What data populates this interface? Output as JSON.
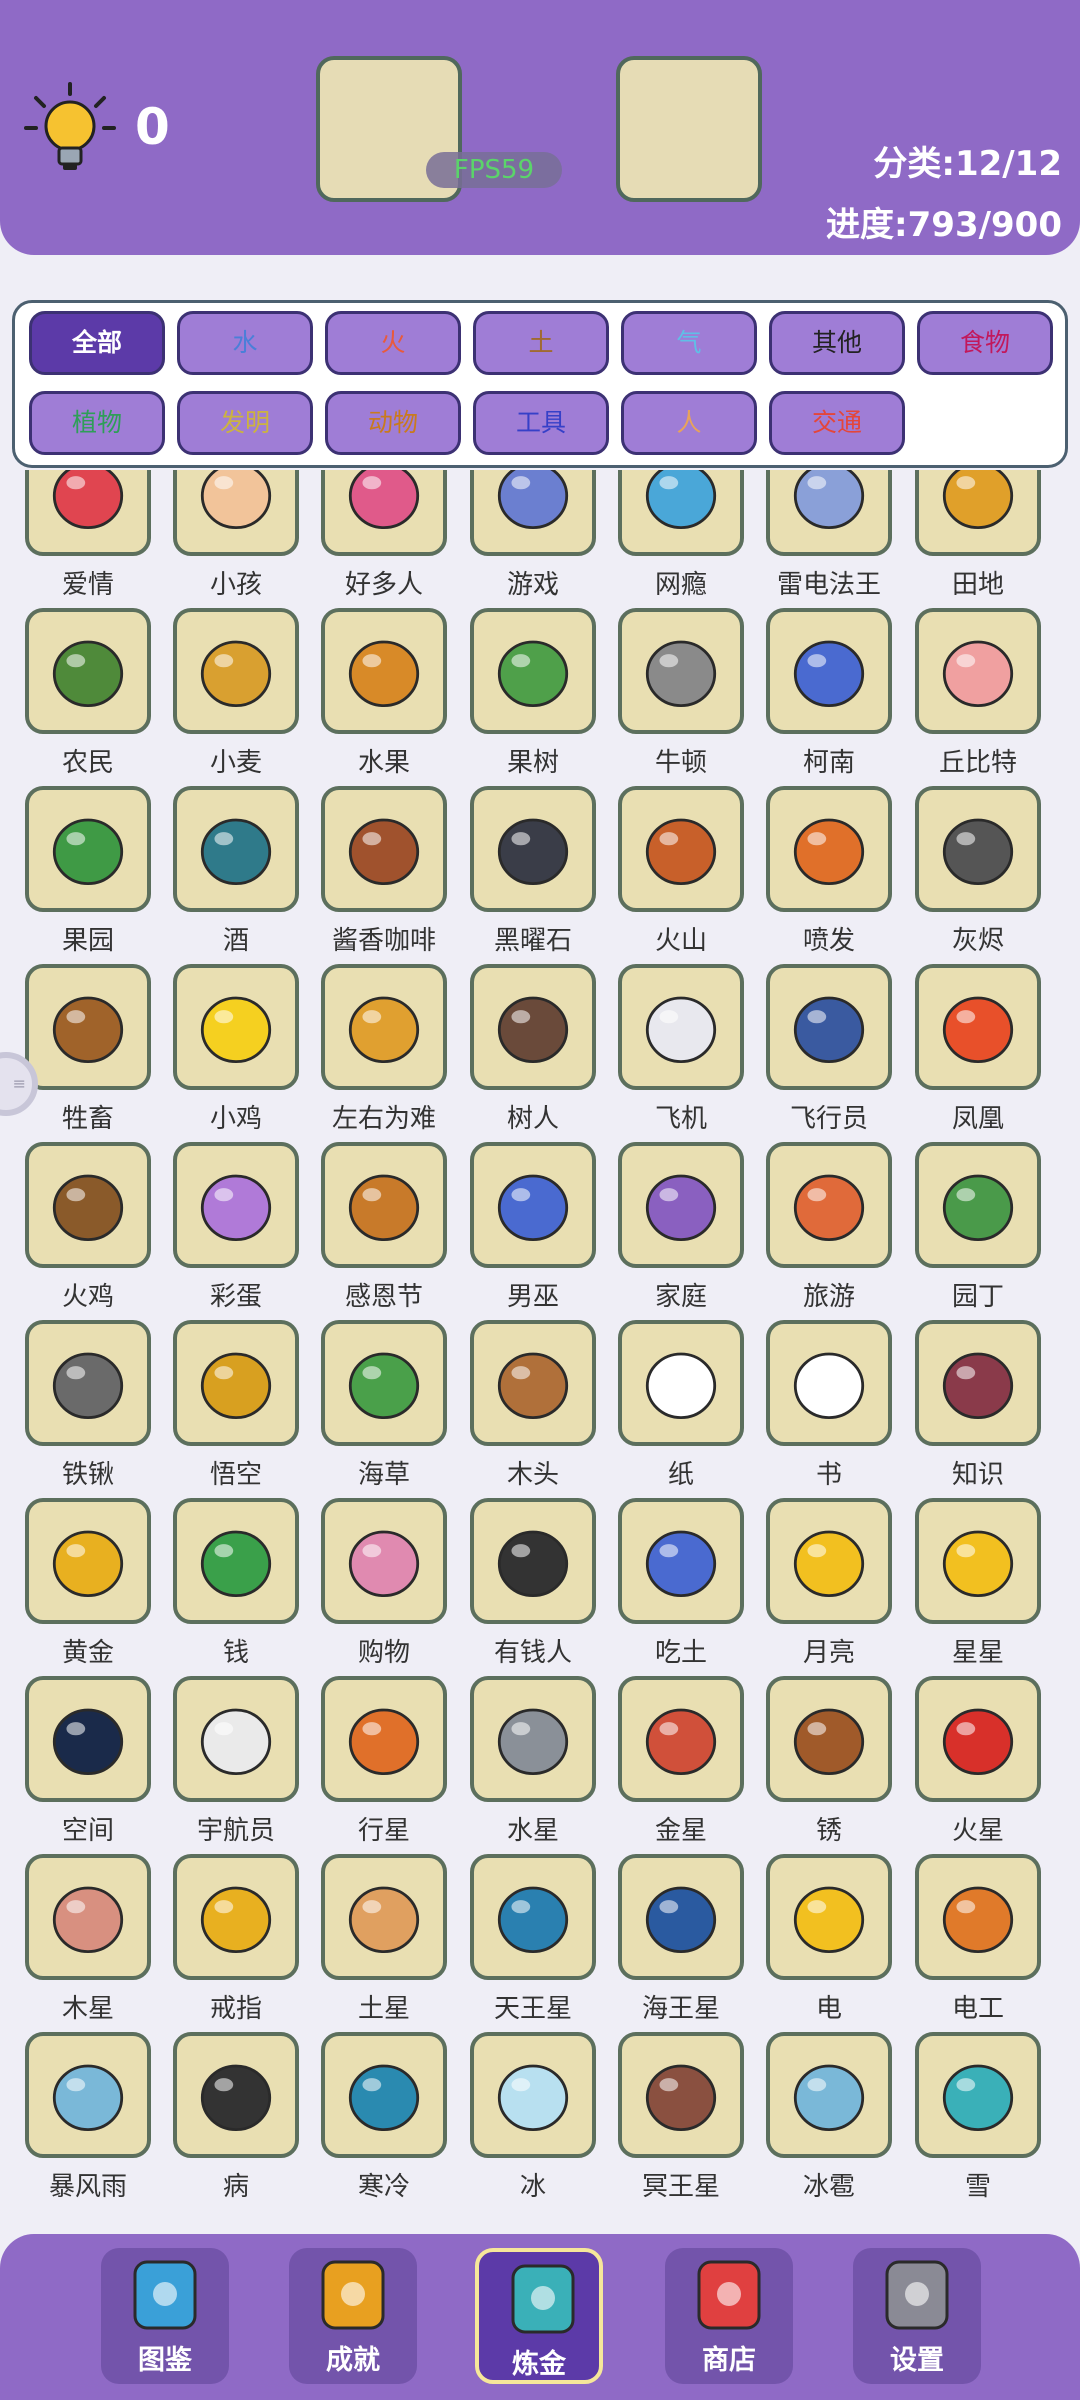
{
  "header": {
    "hint_count": "0",
    "fps": "FPS59",
    "category_text": "分类:12/12",
    "progress_text": "进度:793/900"
  },
  "filters": [
    {
      "label": "全部",
      "color": "#ffffff",
      "active": true
    },
    {
      "label": "水",
      "color": "#4a7fd8"
    },
    {
      "label": "火",
      "color": "#e85a3c"
    },
    {
      "label": "土",
      "color": "#a06a30"
    },
    {
      "label": "气",
      "color": "#5fbfe6"
    },
    {
      "label": "其他",
      "color": "#222222"
    },
    {
      "label": "食物",
      "color": "#c2185b"
    },
    {
      "label": "植物",
      "color": "#2e9e58"
    },
    {
      "label": "发明",
      "color": "#ccb340"
    },
    {
      "label": "动物",
      "color": "#c97a1e"
    },
    {
      "label": "工具",
      "color": "#3640c8"
    },
    {
      "label": "人",
      "color": "#e8a35a"
    },
    {
      "label": "交通",
      "color": "#e4463a"
    }
  ],
  "items": [
    {
      "name": "爱情",
      "icon": "love-icon",
      "color": "#e04550"
    },
    {
      "name": "小孩",
      "icon": "baby-icon",
      "color": "#f2c49a"
    },
    {
      "name": "好多人",
      "icon": "crowd-icon",
      "color": "#e05a8a"
    },
    {
      "name": "游戏",
      "icon": "game-icon",
      "color": "#6b7fd0"
    },
    {
      "name": "网瘾",
      "icon": "internet-addict-icon",
      "color": "#4aa7d8"
    },
    {
      "name": "雷电法王",
      "icon": "thunder-king-icon",
      "color": "#8aa0d8"
    },
    {
      "name": "田地",
      "icon": "field-icon",
      "color": "#e0a02a"
    },
    {
      "name": "农民",
      "icon": "farmer-icon",
      "color": "#4f8a3a"
    },
    {
      "name": "小麦",
      "icon": "wheat-icon",
      "color": "#d9a030"
    },
    {
      "name": "水果",
      "icon": "pineapple-icon",
      "color": "#d88a28"
    },
    {
      "name": "果树",
      "icon": "fruit-tree-icon",
      "color": "#4fa04a"
    },
    {
      "name": "牛顿",
      "icon": "newton-icon",
      "color": "#8a8a8a"
    },
    {
      "name": "柯南",
      "icon": "conan-icon",
      "color": "#4a6ad0"
    },
    {
      "name": "丘比特",
      "icon": "cupid-icon",
      "color": "#f0a0a0"
    },
    {
      "name": "果园",
      "icon": "orchard-icon",
      "color": "#3f9a45"
    },
    {
      "name": "酒",
      "icon": "wine-icon",
      "color": "#2f7a8a"
    },
    {
      "name": "酱香咖啡",
      "icon": "coffee-icon",
      "color": "#a0522d"
    },
    {
      "name": "黑曜石",
      "icon": "obsidian-icon",
      "color": "#3a3d48"
    },
    {
      "name": "火山",
      "icon": "volcano-icon",
      "color": "#c8602a"
    },
    {
      "name": "喷发",
      "icon": "eruption-icon",
      "color": "#e0702a"
    },
    {
      "name": "灰烬",
      "icon": "ash-icon",
      "color": "#555555"
    },
    {
      "name": "牲畜",
      "icon": "livestock-icon",
      "color": "#a0632a"
    },
    {
      "name": "小鸡",
      "icon": "chick-icon",
      "color": "#f5d020"
    },
    {
      "name": "左右为难",
      "icon": "dilemma-icon",
      "color": "#e0a030"
    },
    {
      "name": "树人",
      "icon": "tree-person-icon",
      "color": "#6a4a3a"
    },
    {
      "name": "飞机",
      "icon": "airplane-icon",
      "color": "#e8e8ee"
    },
    {
      "name": "飞行员",
      "icon": "pilot-icon",
      "color": "#3a5aa0"
    },
    {
      "name": "凤凰",
      "icon": "phoenix-icon",
      "color": "#e8502a"
    },
    {
      "name": "火鸡",
      "icon": "turkey-icon",
      "color": "#8a5a2a"
    },
    {
      "name": "彩蛋",
      "icon": "easter-egg-icon",
      "color": "#b07ad8"
    },
    {
      "name": "感恩节",
      "icon": "thanksgiving-icon",
      "color": "#c87a2a"
    },
    {
      "name": "男巫",
      "icon": "wizard-icon",
      "color": "#4a6ad0"
    },
    {
      "name": "家庭",
      "icon": "family-icon",
      "color": "#8a60c0"
    },
    {
      "name": "旅游",
      "icon": "traveler-icon",
      "color": "#e06a3a"
    },
    {
      "name": "园丁",
      "icon": "gardener-icon",
      "color": "#4a9a4a"
    },
    {
      "name": "铁锹",
      "icon": "shovel-icon",
      "color": "#6a6a6a"
    },
    {
      "name": "悟空",
      "icon": "wukong-icon",
      "color": "#d8a020"
    },
    {
      "name": "海草",
      "icon": "seaweed-icon",
      "color": "#4aa04a"
    },
    {
      "name": "木头",
      "icon": "wood-icon",
      "color": "#b0703a"
    },
    {
      "name": "纸",
      "icon": "paper-icon",
      "color": "#ffffff"
    },
    {
      "name": "书",
      "icon": "book-icon",
      "color": "#ffffff"
    },
    {
      "name": "知识",
      "icon": "knowledge-icon",
      "color": "#8a3a4a"
    },
    {
      "name": "黄金",
      "icon": "gold-icon",
      "color": "#e8b020"
    },
    {
      "name": "钱",
      "icon": "money-icon",
      "color": "#3aa04a"
    },
    {
      "name": "购物",
      "icon": "shopping-icon",
      "color": "#e08ab0"
    },
    {
      "name": "有钱人",
      "icon": "rich-man-icon",
      "color": "#333333"
    },
    {
      "name": "吃土",
      "icon": "eating-dirt-icon",
      "color": "#4a6ad0"
    },
    {
      "name": "月亮",
      "icon": "moon-icon",
      "color": "#f2c020"
    },
    {
      "name": "星星",
      "icon": "star-icon",
      "color": "#f2c020"
    },
    {
      "name": "空间",
      "icon": "space-icon",
      "color": "#1a2a4a"
    },
    {
      "name": "宇航员",
      "icon": "astronaut-icon",
      "color": "#eaeaea"
    },
    {
      "name": "行星",
      "icon": "planet-icon",
      "color": "#e0702a"
    },
    {
      "name": "水星",
      "icon": "mercury-icon",
      "color": "#8a9098"
    },
    {
      "name": "金星",
      "icon": "venus-icon",
      "color": "#d0503a"
    },
    {
      "name": "锈",
      "icon": "rust-icon",
      "color": "#a05a2a"
    },
    {
      "name": "火星",
      "icon": "mars-icon",
      "color": "#d8302a"
    },
    {
      "name": "木星",
      "icon": "jupiter-icon",
      "color": "#d89080"
    },
    {
      "name": "戒指",
      "icon": "ring-icon",
      "color": "#e8b020"
    },
    {
      "name": "土星",
      "icon": "saturn-icon",
      "color": "#e0a060"
    },
    {
      "name": "天王星",
      "icon": "uranus-icon",
      "color": "#2a80b0"
    },
    {
      "name": "海王星",
      "icon": "neptune-icon",
      "color": "#2a5aa0"
    },
    {
      "name": "电",
      "icon": "lightning-icon",
      "color": "#f2c020"
    },
    {
      "name": "电工",
      "icon": "electrician-icon",
      "color": "#e07a2a"
    },
    {
      "name": "暴风雨",
      "icon": "storm-icon",
      "color": "#7ab8d8"
    },
    {
      "name": "病",
      "icon": "sick-icon",
      "color": "#333333"
    },
    {
      "name": "寒冷",
      "icon": "cold-icon",
      "color": "#2a8ab0"
    },
    {
      "name": "冰",
      "icon": "ice-icon",
      "color": "#b8e0f0"
    },
    {
      "name": "冥王星",
      "icon": "pluto-icon",
      "color": "#8a5040"
    },
    {
      "name": "冰雹",
      "icon": "hail-icon",
      "color": "#7ab8d8"
    },
    {
      "name": "雪",
      "icon": "snow-icon",
      "color": "#3ab0b8"
    }
  ],
  "nav": [
    {
      "label": "图鉴",
      "icon": "encyclopedia-icon",
      "color": "#3aa0d8"
    },
    {
      "label": "成就",
      "icon": "achievement-medal-icon",
      "color": "#e8a020"
    },
    {
      "label": "炼金",
      "icon": "alchemy-flask-icon",
      "color": "#3ab0b8",
      "active": true
    },
    {
      "label": "商店",
      "icon": "shop-gift-icon",
      "color": "#e04040"
    },
    {
      "label": "设置",
      "icon": "settings-gear-icon",
      "color": "#8a8a95"
    }
  ]
}
